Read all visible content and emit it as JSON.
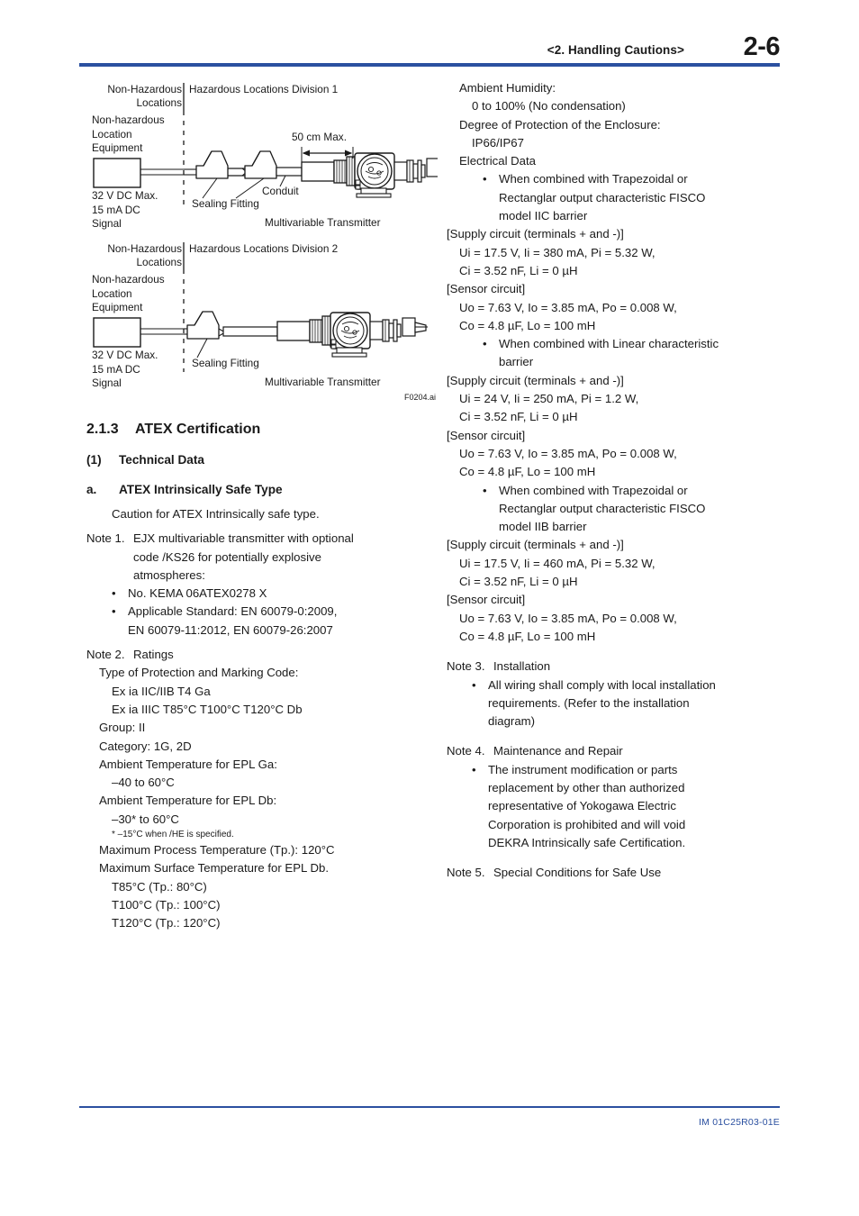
{
  "header": {
    "chapter_ref": "<2.  Handling Cautions>",
    "page_number": "2-6"
  },
  "figure": {
    "caption_id": "F0204.ai",
    "diagram1": {
      "zone_left": "Non-Hazardous\nLocations",
      "zone_right": "Hazardous Locations Division 1",
      "equipment_label": "Non-hazardous\nLocation\nEquipment",
      "signal_label": "32 V DC Max.\n15 mA DC\nSignal",
      "dimension_label": "50 cm Max.",
      "conduit_label": "Conduit",
      "sealing_label": "Sealing Fitting",
      "transmitter_label": "Multivariable Transmitter"
    },
    "diagram2": {
      "zone_left": "Non-Hazardous\nLocations",
      "zone_right": "Hazardous Locations Division 2",
      "equipment_label": "Non-hazardous\nLocation\nEquipment",
      "signal_label": "32 V DC Max.\n15 mA DC\nSignal",
      "sealing_label": "Sealing Fitting",
      "transmitter_label": "Multivariable Transmitter"
    }
  },
  "left_column": {
    "section_number": "2.1.3",
    "section_title": "ATEX Certification",
    "subsection_number": "(1)",
    "subsection_title": "Technical Data",
    "item_letter": "a.",
    "item_title": "ATEX Intrinsically Safe Type",
    "caution_line": "Caution for ATEX Intrinsically safe type.",
    "note1": {
      "label": "Note 1.",
      "body": "EJX multivariable transmitter with optional\ncode /KS26 for potentially explosive\natmospheres:",
      "bullets": [
        "No. KEMA 06ATEX0278 X",
        "Applicable Standard: EN 60079-0:2009,\nEN 60079-11:2012, EN 60079-26:2007"
      ]
    },
    "note2": {
      "label": "Note 2.",
      "title": "Ratings",
      "lines": [
        {
          "indent": 2,
          "text": "Type of Protection and Marking Code:"
        },
        {
          "indent": 3,
          "text": "Ex ia IIC/IIB T4 Ga"
        },
        {
          "indent": 3,
          "text": "Ex ia IIIC T85°C T100°C T120°C Db"
        },
        {
          "indent": 2,
          "text": "Group: II"
        },
        {
          "indent": 2,
          "text": "Category: 1G, 2D"
        },
        {
          "indent": 2,
          "text": "Ambient Temperature for EPL Ga:"
        },
        {
          "indent": 3,
          "text": "–40 to 60°C"
        },
        {
          "indent": 2,
          "text": "Ambient Temperature for EPL Db:"
        },
        {
          "indent": 3,
          "text": "–30* to 60°C"
        }
      ],
      "footnote": "* –15°C when /HE is specified.",
      "lines_after": [
        {
          "indent": 2,
          "text": "Maximum Process Temperature (Tp.): 120°C"
        },
        {
          "indent": 2,
          "text": "Maximum Surface Temperature for EPL Db."
        },
        {
          "indent": 3,
          "text": "T85°C (Tp.: 80°C)"
        },
        {
          "indent": 3,
          "text": "T100°C (Tp.: 100°C)"
        },
        {
          "indent": 3,
          "text": "T120°C (Tp.: 120°C)"
        }
      ]
    }
  },
  "right_column": {
    "specs": [
      {
        "indent": 2,
        "text": "Ambient Humidity:"
      },
      {
        "indent": 3,
        "text": "0 to 100% (No condensation)"
      },
      {
        "indent": 2,
        "text": "Degree of Protection of the Enclosure:"
      },
      {
        "indent": 3,
        "text": "IP66/IP67"
      },
      {
        "indent": 2,
        "text": "Electrical Data"
      }
    ],
    "barrier_blocks": [
      {
        "bullet": "When combined with Trapezoidal or\nRectanglar output characteristic FISCO\nmodel IIC barrier",
        "lines": [
          {
            "indent": 1,
            "text": "[Supply circuit (terminals + and -)]"
          },
          {
            "indent": 2,
            "text": "Ui = 17.5 V, Ii = 380 mA, Pi = 5.32 W,"
          },
          {
            "indent": 2,
            "text": "Ci = 3.52 nF, Li = 0 µH"
          },
          {
            "indent": 1,
            "text": "[Sensor circuit]"
          },
          {
            "indent": 2,
            "text": "Uo = 7.63 V, Io = 3.85 mA, Po = 0.008 W,"
          },
          {
            "indent": 2,
            "text": "Co = 4.8 µF, Lo = 100 mH"
          }
        ]
      },
      {
        "bullet": "When combined with Linear characteristic\nbarrier",
        "lines": [
          {
            "indent": 1,
            "text": "[Supply circuit (terminals + and -)]"
          },
          {
            "indent": 2,
            "text": "Ui = 24 V, Ii = 250 mA, Pi = 1.2 W,"
          },
          {
            "indent": 2,
            "text": "Ci = 3.52 nF, Li = 0 µH"
          },
          {
            "indent": 1,
            "text": "[Sensor circuit]"
          },
          {
            "indent": 2,
            "text": "Uo = 7.63 V, Io = 3.85 mA, Po = 0.008 W,"
          },
          {
            "indent": 2,
            "text": "Co = 4.8 µF, Lo = 100 mH"
          }
        ]
      },
      {
        "bullet": "When combined with Trapezoidal or\nRectanglar output characteristic FISCO\nmodel IIB barrier",
        "lines": [
          {
            "indent": 1,
            "text": "[Supply circuit (terminals + and -)]"
          },
          {
            "indent": 2,
            "text": "Ui = 17.5 V, Ii = 460 mA, Pi = 5.32 W,"
          },
          {
            "indent": 2,
            "text": "Ci = 3.52 nF, Li = 0 µH"
          },
          {
            "indent": 1,
            "text": "[Sensor circuit]"
          },
          {
            "indent": 2,
            "text": "Uo = 7.63 V, Io = 3.85 mA, Po = 0.008 W,"
          },
          {
            "indent": 2,
            "text": "Co = 4.8 µF, Lo = 100 mH"
          }
        ]
      }
    ],
    "note3": {
      "label": "Note 3.",
      "title": "Installation",
      "bullets": [
        "All wiring shall comply with local installation\nrequirements. (Refer to the installation\ndiagram)"
      ]
    },
    "note4": {
      "label": "Note 4.",
      "title": "Maintenance and Repair",
      "bullets": [
        "The instrument modification or parts\nreplacement by other than authorized\nrepresentative of Yokogawa Electric\nCorporation is prohibited and will void\nDEKRA Intrinsically safe Certification."
      ]
    },
    "note5": {
      "label": "Note 5.",
      "title": "Special Conditions for Safe Use"
    }
  },
  "footer": {
    "document_code": "IM 01C25R03-01E"
  },
  "colors": {
    "accent_blue": "#2b50a0",
    "text": "#1a1a1a"
  }
}
